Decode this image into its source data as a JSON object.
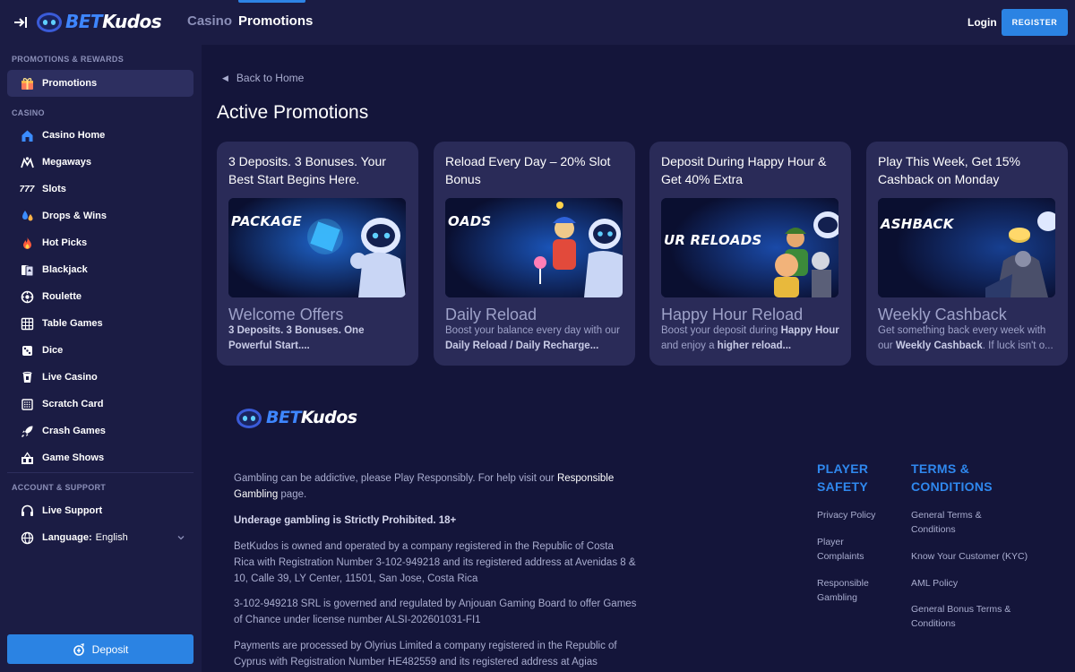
{
  "brand": {
    "bet": "BET",
    "kudos": "Kudos"
  },
  "header": {
    "nav": [
      {
        "label": "Casino"
      },
      {
        "label": "Promotions"
      }
    ],
    "login": "Login",
    "register": "REGISTER"
  },
  "sidebar": {
    "sections": {
      "promotions": "PROMOTIONS & REWARDS",
      "casino": "CASINO",
      "account": "ACCOUNT & SUPPORT"
    },
    "promotions_items": [
      {
        "label": "Promotions",
        "icon": "gift-icon"
      }
    ],
    "casino_items": [
      {
        "label": "Casino Home",
        "icon": "home-icon"
      },
      {
        "label": "Megaways",
        "icon": "megaways-icon"
      },
      {
        "label": "Slots",
        "icon": "slots-777-icon"
      },
      {
        "label": "Drops & Wins",
        "icon": "drops-icon"
      },
      {
        "label": "Hot Picks",
        "icon": "fire-icon"
      },
      {
        "label": "Blackjack",
        "icon": "cards-icon"
      },
      {
        "label": "Roulette",
        "icon": "roulette-icon"
      },
      {
        "label": "Table Games",
        "icon": "table-icon"
      },
      {
        "label": "Dice",
        "icon": "dice-icon"
      },
      {
        "label": "Live Casino",
        "icon": "live-casino-icon"
      },
      {
        "label": "Scratch Card",
        "icon": "scratch-card-icon"
      },
      {
        "label": "Crash Games",
        "icon": "rocket-icon"
      },
      {
        "label": "Game Shows",
        "icon": "game-shows-icon"
      }
    ],
    "account_items": [
      {
        "label": "Live Support",
        "icon": "headset-icon"
      },
      {
        "label": "Language:",
        "value": "English",
        "icon": "globe-icon"
      }
    ],
    "deposit": "Deposit"
  },
  "main": {
    "back": "Back to Home",
    "title": "Active Promotions",
    "cards": [
      {
        "title": "3 Deposits. 3 Bonuses. Your Best Start Begins Here.",
        "image_text": "PACKAGE",
        "name": "Welcome Offers",
        "desc_bold": "3 Deposits. 3 Bonuses. One Powerful Start...."
      },
      {
        "title": "Reload Every Day – 20% Slot Bonus",
        "image_text": "OADS",
        "name": "Daily Reload",
        "desc_a": "Boost your balance every day with our ",
        "desc_b": "Daily Reload / Daily Recharge..."
      },
      {
        "title": "Deposit During Happy Hour & Get 40% Extra",
        "image_text": "UR RELOADS",
        "name": "Happy Hour Reload",
        "desc_a": "Boost your deposit during ",
        "desc_b": "Happy Hour",
        "desc_c": " and enjoy a ",
        "desc_d": "higher reload..."
      },
      {
        "title": "Play This Week, Get 15% Cashback on Monday",
        "image_text": "ASHBACK",
        "name": "Weekly Cashback",
        "desc_a": "Get something back every week with our ",
        "desc_b": "Weekly Cashback",
        "desc_c": ". If luck isn't o..."
      }
    ]
  },
  "footer": {
    "p1_a": "Gambling can be addictive, please Play Responsibly. For help visit our ",
    "p1_link": "Responsible Gambling",
    "p1_b": " page.",
    "p2": "Underage gambling is Strictly Prohibited. 18+",
    "p3": "BetKudos is owned and operated by a company registered in the Republic of Costa Rica with Registration Number 3-102-949218 and its registered address at Avenidas 8 & 10, Calle 39, LY Center, 11501, San Jose, Costa Rica",
    "p4": "3-102-949218 SRL is governed and regulated by Anjouan Gaming Board to offer Games of Chance under license number ALSI-202601031-FI1",
    "p5": "Payments are processed by Olyrius Limited a company registered in the Republic of Cyprus with Registration Number HE482559 and its registered address at Agias",
    "player_safety": {
      "title_1": "PLAYER",
      "title_2": "SAFETY",
      "links": [
        "Privacy Policy",
        "Player Complaints",
        "Responsible Gambling"
      ]
    },
    "terms": {
      "title_1": "TERMS &",
      "title_2": "CONDITIONS",
      "links": [
        "General Terms & Conditions",
        "Know Your Customer (KYC)",
        "AML Policy",
        "General Bonus Terms & Conditions"
      ]
    }
  },
  "colors": {
    "accent": "#2b83e3",
    "background": "#14153a",
    "panel": "#1b1c44",
    "card": "#2a2b58",
    "link_blue": "#2f88ee"
  }
}
